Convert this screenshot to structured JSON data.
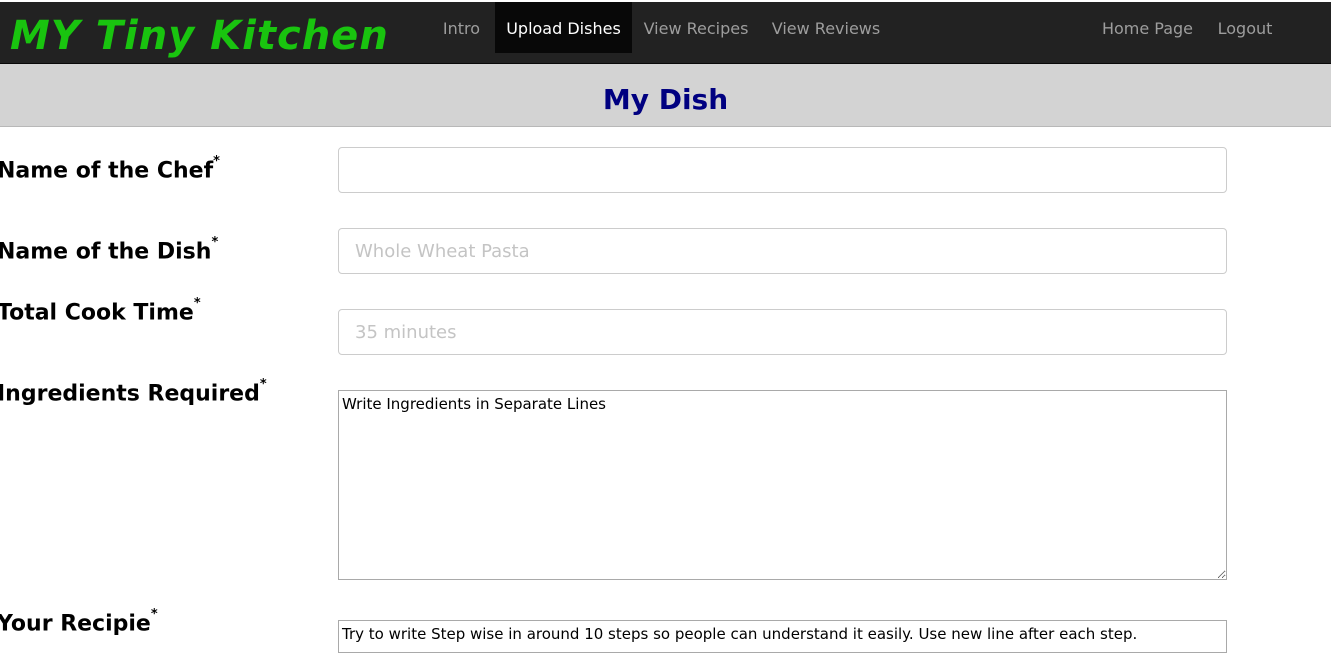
{
  "brand": "MY Tiny Kitchen",
  "nav": {
    "intro": "Intro",
    "upload": "Upload Dishes",
    "recipes": "View Recipes",
    "reviews": "View Reviews",
    "home": "Home Page",
    "logout": "Logout"
  },
  "page_title": "My Dish",
  "form": {
    "required_mark": "*",
    "chef_label": "Name of the Chef",
    "chef_value": "",
    "dish_label": "Name of the Dish",
    "dish_placeholder": "Whole Wheat Pasta",
    "time_label": "Total Cook Time",
    "time_placeholder": "35 minutes",
    "ingredients_label": "Ingredients Required",
    "ingredients_placeholder": "Write Ingredients in Separate Lines",
    "recipe_label": "Your Recipie",
    "recipe_placeholder": "Try to write Step wise in around 10 steps so people can understand it easily. Use new line after each step."
  },
  "colors": {
    "navbar": "#222222",
    "brand": "#19c40f",
    "active_tab": "#080808",
    "heading_bar": "#d3d3d3",
    "heading_text": "#000080"
  }
}
